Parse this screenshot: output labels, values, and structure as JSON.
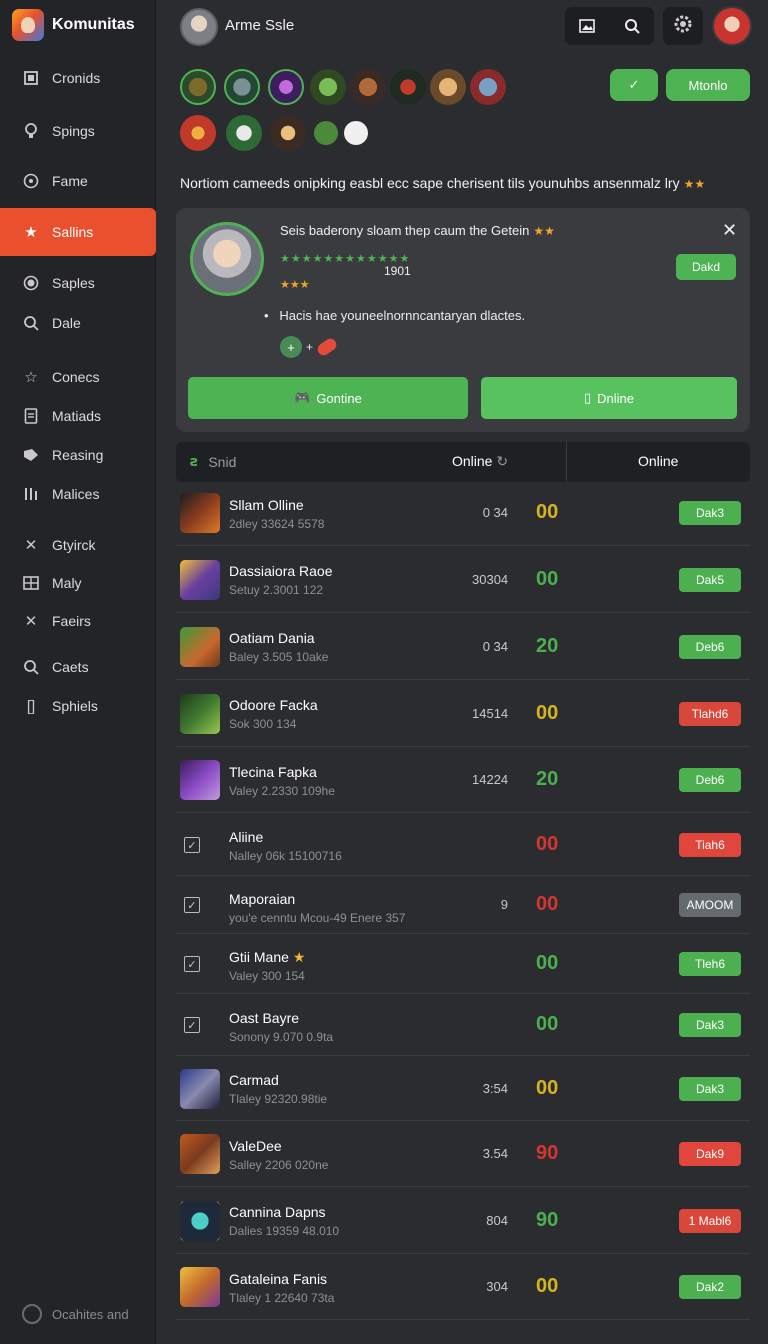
{
  "sidebar": {
    "brand": "Komunitas",
    "items": [
      {
        "label": "Cronids",
        "icon": "bookmark-icon"
      },
      {
        "label": "Spings",
        "icon": "lightbulb-icon"
      },
      {
        "label": "Fame",
        "icon": "circle-icon"
      },
      {
        "label": "Sallins",
        "icon": "star-icon",
        "active": true
      },
      {
        "label": "Saples",
        "icon": "dot-icon"
      },
      {
        "label": "Dale",
        "icon": "search-icon"
      },
      {
        "label": "Conecs",
        "icon": "star-outline-icon"
      },
      {
        "label": "Matiads",
        "icon": "document-icon"
      },
      {
        "label": "Reasing",
        "icon": "tag-icon"
      },
      {
        "label": "Malices",
        "icon": "bars-icon"
      },
      {
        "label": "Gtyirck",
        "icon": "cross-icon"
      },
      {
        "label": "Maly",
        "icon": "grid-icon"
      },
      {
        "label": "Faeirs",
        "icon": "cross-icon"
      },
      {
        "label": "Caets",
        "icon": "search-icon"
      },
      {
        "label": "Sphiels",
        "icon": "bracket-icon"
      }
    ],
    "footer": "Ocahites and"
  },
  "header": {
    "user_name": "Arme Ssle"
  },
  "quick_actions": {
    "left_pill": "✓",
    "right_pill": "Mtonlo"
  },
  "banner": {
    "text": "Nortiom cameeds onipking easbl ecc sape cherisent tils younuhbs ansenmalz lry"
  },
  "card": {
    "title": "Seis baderony sloam thep caum the Getein",
    "value": "1901",
    "badge": "Dakd",
    "bullet": "Hacis hae youneelnornncantaryan dlactes.",
    "button_primary": "Gontine",
    "button_secondary": "Dnline"
  },
  "table": {
    "col_first": "Snid",
    "col_mid": "Online",
    "col_last": "Online",
    "rows": [
      {
        "name": "Sllam Olline",
        "sub": "2dley 33624 5578",
        "mid": "0 34",
        "score": "00",
        "score_color": "#d4b51d",
        "tag": "Dak3",
        "tag_color": "#4cb050",
        "thumb": "a"
      },
      {
        "name": "Dassiaiora Raoe",
        "sub": "Setuy 2.3001 122",
        "mid": "30304",
        "score": "00",
        "score_color": "#4cb050",
        "tag": "Dak5",
        "tag_color": "#4cb050",
        "thumb": "b"
      },
      {
        "name": "Oatiam Dania",
        "sub": "Baley 3.505 10ake",
        "mid": "0 34",
        "score": "20",
        "score_color": "#4cb050",
        "tag": "Deb6",
        "tag_color": "#4cb050",
        "thumb": "c"
      },
      {
        "name": "Odoore Facka",
        "sub": "Sok 300 134",
        "mid": "14514",
        "score": "00",
        "score_color": "#d4b51d",
        "tag": "Tlahd6",
        "tag_color": "#d9473b",
        "thumb": "d"
      },
      {
        "name": "Tlecina Fapka",
        "sub": "Valey 2.2330 109he",
        "mid": "14224",
        "score": "20",
        "score_color": "#4cb050",
        "tag": "Deb6",
        "tag_color": "#4cb050",
        "thumb": "e"
      },
      {
        "name": "Aliine",
        "sub": "Nalley 06k 15100716",
        "mid": "",
        "score": "00",
        "score_color": "#d3372f",
        "tag": "Tiah6",
        "tag_color": "#e0463b",
        "check": true
      },
      {
        "name": "Maporaian",
        "sub": "you'e cenntu Mcou-49 Enere 357",
        "mid": "9",
        "score": "00",
        "score_color": "#d3372f",
        "tag": "AMOOM",
        "tag_color": "#656a6e",
        "check": true
      },
      {
        "name": "Gtii Mane",
        "sub": "Valey 300 154",
        "mid": "",
        "score": "00",
        "score_color": "#4cb050",
        "tag": "Tleh6",
        "tag_color": "#4cb050",
        "check": true,
        "star": true
      },
      {
        "name": "Oast Bayre",
        "sub": "Sonony 9.070 0.9ta",
        "mid": "",
        "score": "00",
        "score_color": "#4cb050",
        "tag": "Dak3",
        "tag_color": "#4cb050",
        "check": true
      },
      {
        "name": "Carmad",
        "sub": "Tlaley 92320.98tie",
        "mid": "3:54",
        "score": "00",
        "score_color": "#d4b51d",
        "tag": "Dak3",
        "tag_color": "#4cb050",
        "thumb": "f"
      },
      {
        "name": "ValeDee",
        "sub": "Salley 2206 020ne",
        "mid": "3.54",
        "score": "90",
        "score_color": "#d3372f",
        "tag": "Dak9",
        "tag_color": "#e0463b",
        "thumb": "g"
      },
      {
        "name": "Cannina Dapns",
        "sub": "Dalies 19359 48.010",
        "mid": "804",
        "score": "90",
        "score_color": "#4cb050",
        "tag": "1 Mabl6",
        "tag_color": "#d9473b",
        "thumb": "h"
      },
      {
        "name": "Gataleina Fanis",
        "sub": "Tlaley 1 22640 73ta",
        "mid": "304",
        "score": "00",
        "score_color": "#d4b51d",
        "tag": "Dak2",
        "tag_color": "#4cb050",
        "thumb": "i"
      }
    ]
  },
  "colors": {
    "accent": "#e8502e",
    "green": "#4db353",
    "red": "#e0463b",
    "gold": "#d4b51d"
  }
}
